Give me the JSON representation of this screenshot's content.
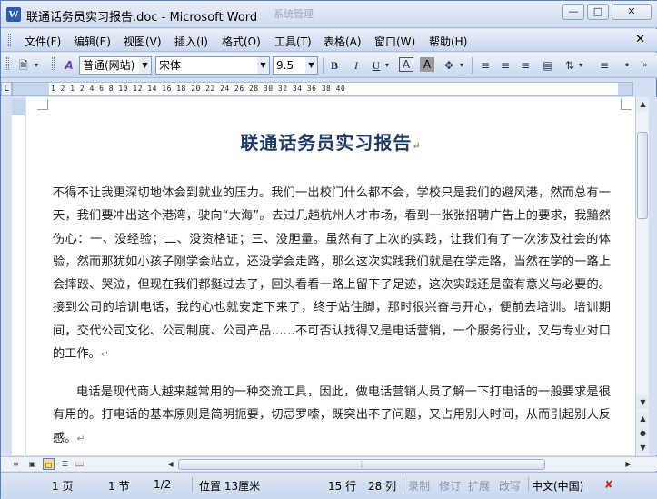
{
  "window": {
    "title": "联通话务员实习报告.doc - Microsoft Word",
    "ghost_tab": "系统管理",
    "app_icon": "W"
  },
  "menu": [
    "文件(F)",
    "编辑(E)",
    "视图(V)",
    "插入(I)",
    "格式(O)",
    "工具(T)",
    "表格(A)",
    "窗口(W)",
    "帮助(H)"
  ],
  "toolbar": {
    "style_value": "普通(网站)",
    "font_value": "宋体",
    "size_value": "9.5",
    "bold": "B",
    "italic": "I",
    "underline": "U"
  },
  "ruler": {
    "numbers": "1  2  1  2  4  6  8  10  12  14  16  18  20  22  24  26  28  30  32  34  36  38   40"
  },
  "document": {
    "title": "联通话务员实习报告",
    "para1": "不得不让我更深切地体会到就业的压力。我们一出校门什么都不会，学校只是我们的避风港，然而总有一天，我们要冲出这个港湾，驶向“大海”。去过几趟杭州人才市场，看到一张张招聘广告上的要求，我黯然伤心：一、没经验；二、没资格证；三、没胆量。虽然有了上次的实践，让我们有了一次涉及社会的体验，然而那犹如小孩子刚学会站立，还没学会走路，那么这次实践我们就是在学走路，当然在学的一路上会摔跤、哭泣，但现在我们都挺过去了，回头看看一路上留下了足迹，这次实践还是蛮有意义与必要的。接到公司的培训电话，我的心也就安定下来了，终于站住脚，那时很兴奋与开心，便前去培训。培训期间，交代公司文化、公司制度、公司产品……不可否认找得又是电话营销，一个服务行业，又与专业对口的工作。",
    "para2": "电话是现代商人越来越常用的一种交流工具，因此，做电话营销人员了解一下打电话的一般要求是很有用的。打电话的基本原则是简明扼要，切忌罗嗦，既突出不了问题，又占用别人时间，从而引起别人反感。",
    "para_mark": "↵"
  },
  "status": {
    "page": "1 页",
    "section": "1 节",
    "page_of": "1/2",
    "position": "位置 13厘米",
    "line": "15 行",
    "column": "28 列",
    "rec": "录制",
    "trk": "修订",
    "ext": "扩展",
    "ovr": "改写",
    "language": "中文(中国)"
  }
}
